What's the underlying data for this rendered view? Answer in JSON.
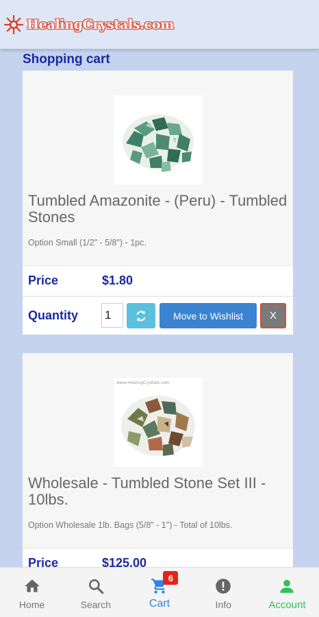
{
  "header": {
    "logo_text": "HealingCrystals.com",
    "brand_color": "#d6402a"
  },
  "page": {
    "title": "Shopping cart"
  },
  "cart_items": [
    {
      "title": "Tumbled Amazonite - (Peru) - Tumbled Stones",
      "option": "Option Small (1/2\" - 5/8\") - 1pc.",
      "price_label": "Price",
      "price": "$1.80",
      "quantity_label": "Quantity",
      "quantity": "1",
      "move_to_wishlist_label": "Move to Wishlist",
      "remove_label": "X",
      "image_icon": "amazonite-stones-image"
    },
    {
      "title": "Wholesale - Tumbled Stone Set III - 10lbs.",
      "option": "Option Wholesale 1lb. Bags (5/8\" - 1\") - Total of 10lbs.",
      "price_label": "Price",
      "price": "$125.00",
      "image_caption": "www.HealingCrystals.com",
      "image_icon": "tumbled-stone-set-image"
    }
  ],
  "bottom_nav": {
    "items": [
      {
        "label": "Home",
        "icon": "home-icon"
      },
      {
        "label": "Search",
        "icon": "search-icon"
      },
      {
        "label": "Cart",
        "icon": "cart-icon",
        "badge": "6",
        "active": true,
        "color": "#2f86e0"
      },
      {
        "label": "Info",
        "icon": "info-icon"
      },
      {
        "label": "Account",
        "icon": "account-icon",
        "color": "#2fc157"
      }
    ]
  },
  "colors": {
    "accent_navy": "#1b2aa2",
    "refresh_button": "#5bc0de",
    "wishlist_button": "#3a83d1",
    "badge_red": "#e3241b"
  }
}
